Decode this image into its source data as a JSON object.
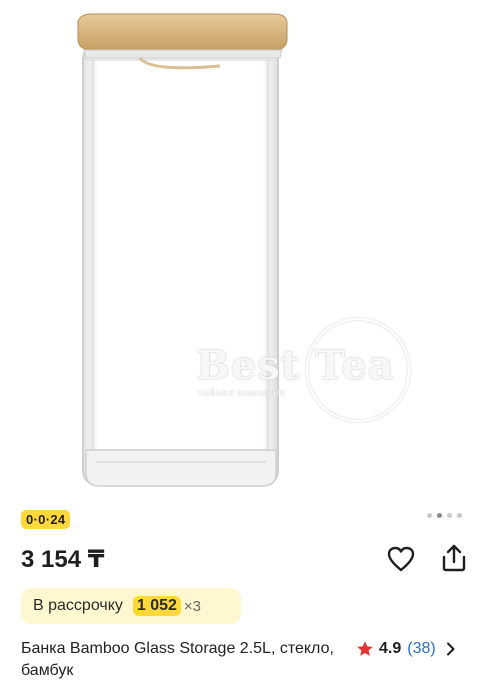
{
  "product": {
    "title": "Банка Bamboo Glass Storage 2.5L, стекло, бамбук",
    "price": "3 154 ₸",
    "promo_badge": "0·0·24",
    "installment": {
      "label": "В рассрочку",
      "amount": "1 052",
      "times": "×3"
    },
    "rating": {
      "value": "4.9",
      "reviews": "(38)"
    },
    "gallery": {
      "total": 4,
      "active_index": 1
    }
  },
  "watermark": {
    "text": "Best Tea",
    "subtext": "чайная компания"
  },
  "icons": {
    "favorite": "heart-icon",
    "share": "share-icon",
    "rating": "star-icon",
    "more": "chevron-right-icon"
  },
  "colors": {
    "promo_yellow": "#ffd83a",
    "installment_bg": "#fff7cf",
    "star_red": "#e3342f",
    "link_blue": "#2a6fc9"
  }
}
